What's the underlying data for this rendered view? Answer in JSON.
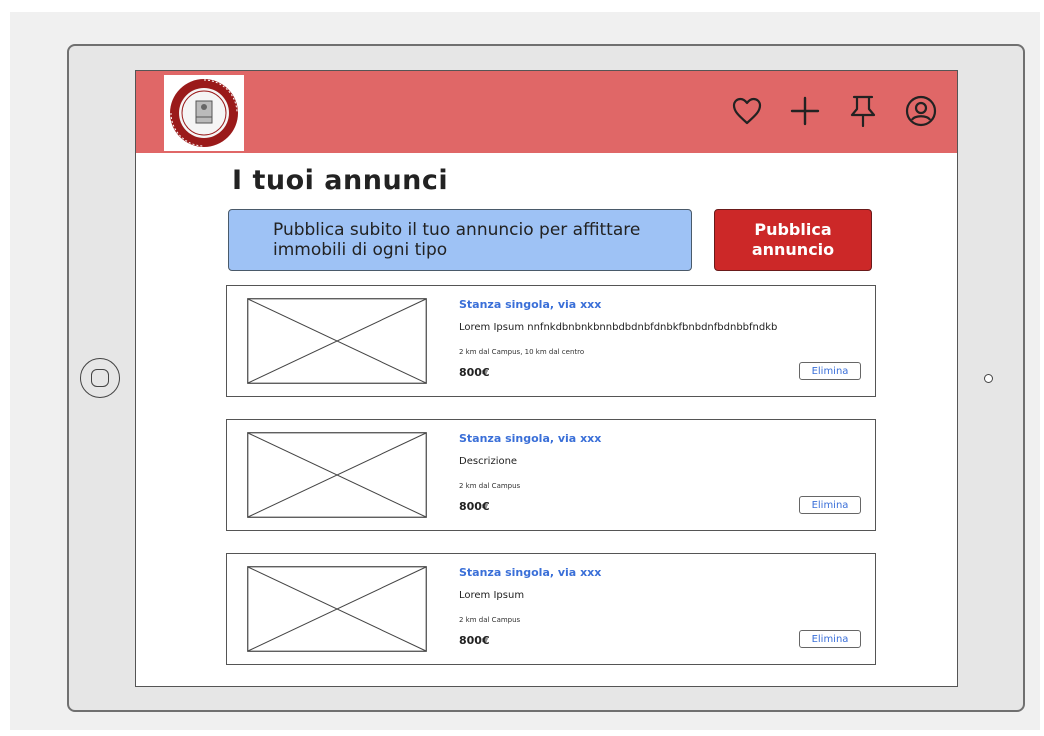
{
  "header": {
    "logo": "university-seal",
    "background": "#e06767",
    "icons": [
      "heart-icon",
      "plus-icon",
      "pin-icon",
      "user-icon"
    ]
  },
  "page": {
    "title": "I tuoi annunci"
  },
  "promo": {
    "text": "Pubblica subito il tuo annuncio per affittare immobili di ogni tipo"
  },
  "publish_button": {
    "label": "Pubblica annuncio",
    "color": "#cc2828"
  },
  "listings": [
    {
      "title": "Stanza singola, via xxx",
      "description": "Lorem Ipsum nnfnkdbnbnkbnnbdbdnbfdnbkfbnbdnfbdnbbfndkb",
      "distance": "2 km dal Campus, 10 km dal centro",
      "price": "800€",
      "delete_label": "Elimina"
    },
    {
      "title": "Stanza singola, via xxx",
      "description": "Descrizione",
      "distance": "2 km dal Campus",
      "price": "800€",
      "delete_label": "Elimina"
    },
    {
      "title": "Stanza singola, via xxx",
      "description": "Lorem Ipsum",
      "distance": "2 km dal Campus",
      "price": "800€",
      "delete_label": "Elimina"
    }
  ]
}
